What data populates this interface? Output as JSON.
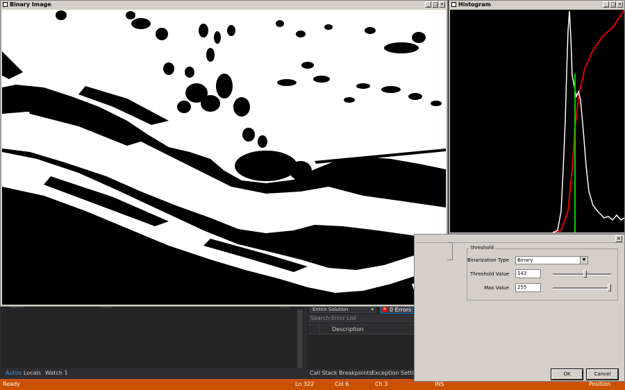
{
  "binary_window": {
    "title": "Binary Image"
  },
  "histogram_window": {
    "title": "Histogram"
  },
  "title_buttons": {
    "minimize": "_",
    "maximize": "□",
    "close": "×"
  },
  "threshold_dialog": {
    "group_label": "threshold",
    "binarization_label": "Binarization Type",
    "binarization_value": "Binary",
    "threshold_label": "Threshold Value",
    "threshold_value": "143",
    "threshold_slider_fraction": 0.56,
    "max_label": "Max Value",
    "max_value": "255",
    "max_slider_fraction": 1.0,
    "ok_label": "OK",
    "cancel_label": "Cancel",
    "close_label": "×"
  },
  "ide": {
    "locals_columns": [
      "Name",
      "Value",
      "Type"
    ],
    "bottom_tabs": [
      "Autos",
      "Locals",
      "Watch 1"
    ],
    "error_scope": "Entire Solution",
    "error_badge": "0 Errors",
    "error_search_placeholder": "Search Error List",
    "error_col_description": "Description",
    "error_tabs": [
      "Call Stack",
      "Breakpoints",
      "Exception Setting"
    ],
    "status": {
      "ready": "Ready",
      "line": "Ln 322",
      "col": "Col 6",
      "ch": "Ch 3",
      "ins": "INS",
      "position": "Position"
    }
  },
  "colors": {
    "status_bar": "#ca5100",
    "histogram_curve": "#ffffff",
    "cumulative_curve": "#e00000",
    "threshold_line": "#00d000"
  }
}
